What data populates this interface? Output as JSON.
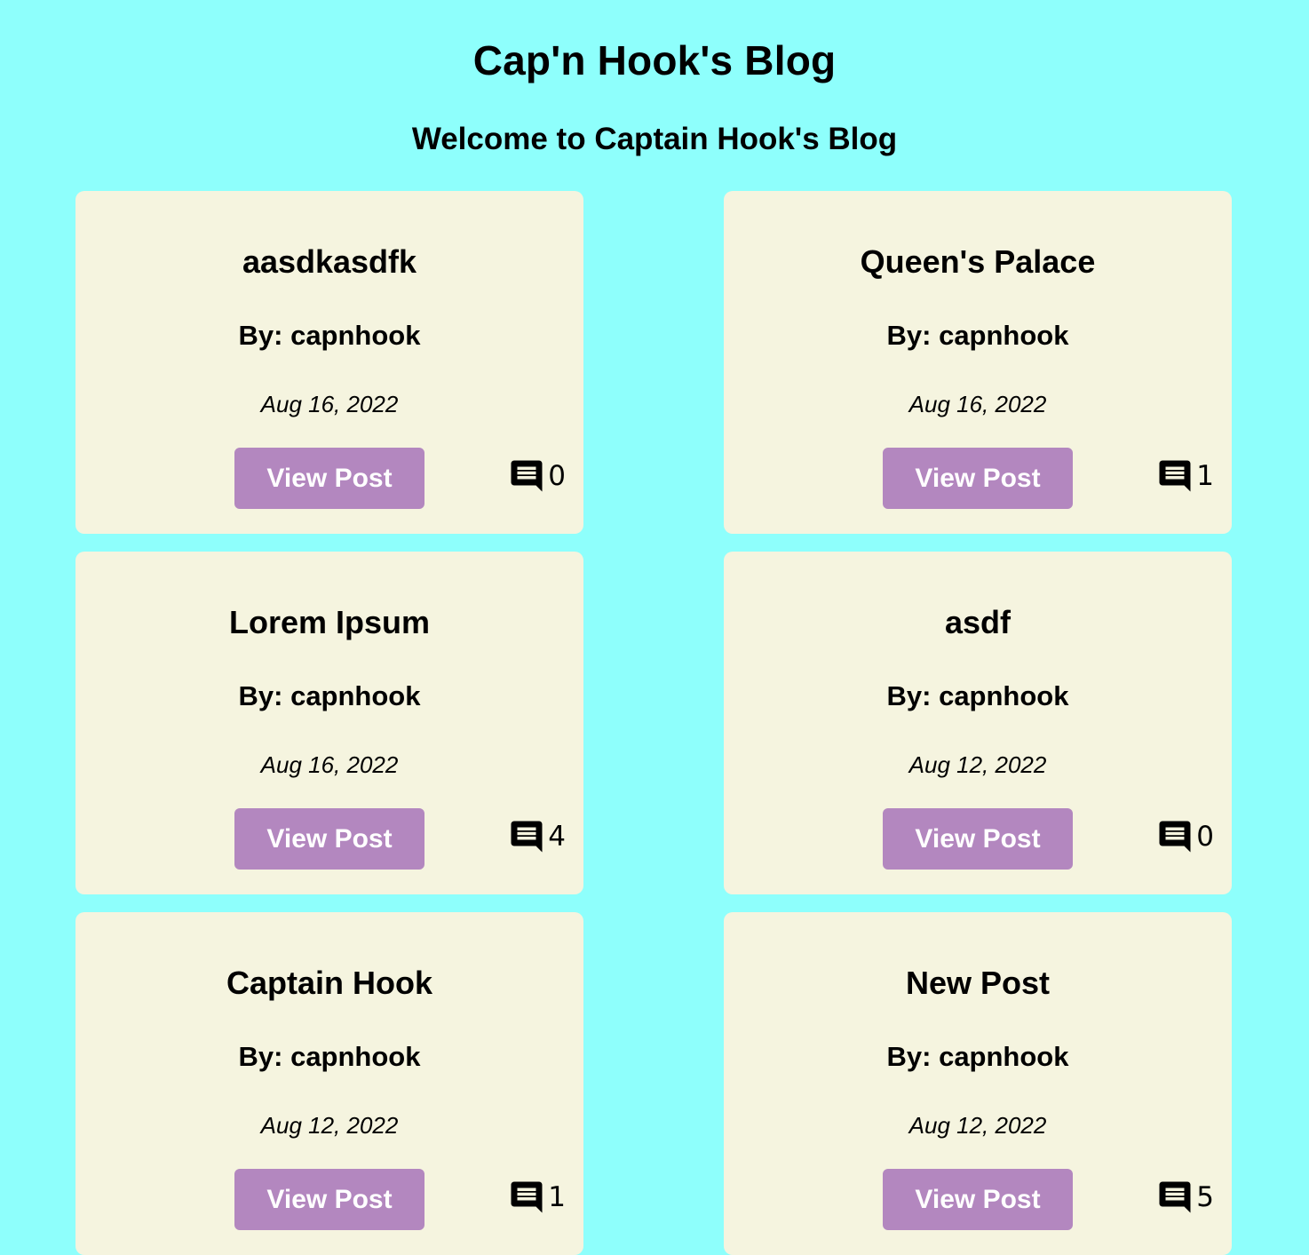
{
  "header": {
    "title": "Cap'n Hook's Blog",
    "subtitle": "Welcome to Captain Hook's Blog"
  },
  "posts": [
    {
      "title": "aasdkasdfk",
      "author": "By: capnhook",
      "date": "Aug 16, 2022",
      "button_label": "View Post",
      "comment_count": "0",
      "comment_icon": "comment-icon"
    },
    {
      "title": "Queen's Palace",
      "author": "By: capnhook",
      "date": "Aug 16, 2022",
      "button_label": "View Post",
      "comment_count": "1",
      "comment_icon": "comment-icon"
    },
    {
      "title": "Lorem Ipsum",
      "author": "By: capnhook",
      "date": "Aug 16, 2022",
      "button_label": "View Post",
      "comment_count": "4",
      "comment_icon": "comment-icon"
    },
    {
      "title": "asdf",
      "author": "By: capnhook",
      "date": "Aug 12, 2022",
      "button_label": "View Post",
      "comment_count": "0",
      "comment_icon": "comment-icon"
    },
    {
      "title": "Captain Hook",
      "author": "By: capnhook",
      "date": "Aug 12, 2022",
      "button_label": "View Post",
      "comment_count": "1",
      "comment_icon": "comment-icon"
    },
    {
      "title": "New Post",
      "author": "By: capnhook",
      "date": "Aug 12, 2022",
      "button_label": "View Post",
      "comment_count": "5",
      "comment_icon": "comment-icon"
    }
  ],
  "colors": {
    "background": "#8efffc",
    "card": "#f5f4df",
    "button": "#b387bf",
    "button_text": "#ffffff"
  }
}
